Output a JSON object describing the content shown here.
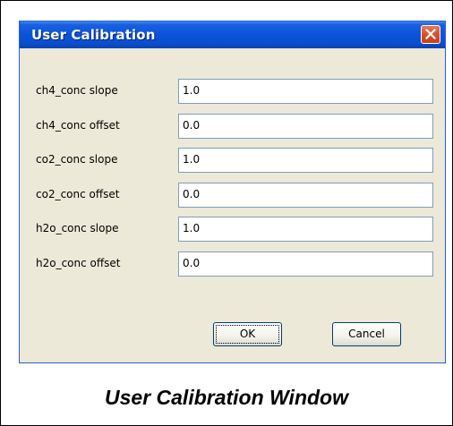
{
  "window": {
    "title": "User Calibration",
    "close_icon": "close-icon"
  },
  "fields": [
    {
      "label": "ch4_conc slope",
      "value": "1.0"
    },
    {
      "label": "ch4_conc offset",
      "value": "0.0"
    },
    {
      "label": "co2_conc slope",
      "value": "1.0"
    },
    {
      "label": "co2_conc offset",
      "value": "0.0"
    },
    {
      "label": "h2o_conc slope",
      "value": "1.0"
    },
    {
      "label": "h2o_conc offset",
      "value": "0.0"
    }
  ],
  "buttons": {
    "ok_label": "OK",
    "cancel_label": "Cancel"
  },
  "caption": "User Calibration Window",
  "colors": {
    "titlebar": "#0a53d8",
    "dialog_bg": "#ece9d8",
    "close_button": "#d84b22"
  }
}
